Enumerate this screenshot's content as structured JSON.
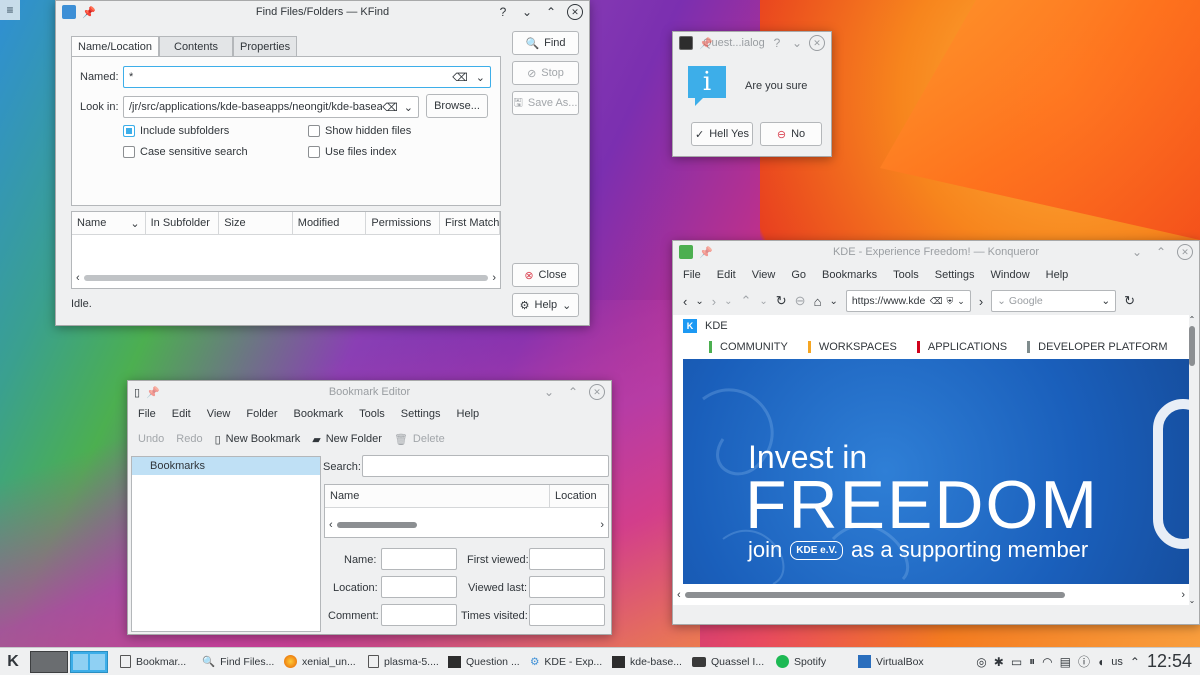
{
  "kfind": {
    "title": "Find Files/Folders — KFind",
    "tabs": [
      "Name/Location",
      "Contents",
      "Properties"
    ],
    "named_label": "Named:",
    "named_value": "*",
    "lookin_label": "Look in:",
    "lookin_value": "/jr/src/applications/kde-baseapps/neongit/kde-baseapps",
    "browse": "Browse...",
    "checks": [
      {
        "label": "Include subfolders",
        "checked": true
      },
      {
        "label": "Show hidden files",
        "checked": false
      },
      {
        "label": "Case sensitive search",
        "checked": false
      },
      {
        "label": "Use files index",
        "checked": false
      }
    ],
    "columns": [
      "Name",
      "In Subfolder",
      "Size",
      "Modified",
      "Permissions",
      "First Match"
    ],
    "find": "Find",
    "stop": "Stop",
    "saveas": "Save As...",
    "close": "Close",
    "help": "Help",
    "status": "Idle."
  },
  "question": {
    "title": "Quest...ialog",
    "text": "Are you sure",
    "yes": "Hell Yes",
    "no": "No"
  },
  "bookmark": {
    "title": "Bookmark Editor",
    "menu": [
      "File",
      "Edit",
      "View",
      "Folder",
      "Bookmark",
      "Tools",
      "Settings",
      "Help"
    ],
    "toolbar": {
      "undo": "Undo",
      "redo": "Redo",
      "new_bookmark": "New Bookmark",
      "new_folder": "New Folder",
      "delete": "Delete"
    },
    "tree_item": "Bookmarks",
    "search_label": "Search:",
    "columns": [
      "Name",
      "Location"
    ],
    "form": {
      "name": "Name:",
      "location": "Location:",
      "comment": "Comment:",
      "first_viewed": "First viewed:",
      "viewed_last": "Viewed last:",
      "times_visited": "Times visited:"
    }
  },
  "konqueror": {
    "title": "KDE - Experience Freedom! — Konqueror",
    "menu": [
      "File",
      "Edit",
      "View",
      "Go",
      "Bookmarks",
      "Tools",
      "Settings",
      "Window",
      "Help"
    ],
    "url": "https://www.kde",
    "search_placeholder": "Google",
    "site_name": "KDE",
    "nav": [
      {
        "label": "COMMUNITY",
        "color": "#4caf50"
      },
      {
        "label": "WORKSPACES",
        "color": "#f5a623"
      },
      {
        "label": "APPLICATIONS",
        "color": "#d0021b"
      },
      {
        "label": "DEVELOPER PLATFORM",
        "color": "#7f8c8d"
      }
    ],
    "banner": {
      "line1": "Invest in",
      "line2": "FREEDOM",
      "line3a": "join",
      "line3b": "as a supporting member",
      "ev_label": "KDE e.V."
    }
  },
  "taskbar": {
    "tasks": [
      "Bookmar...",
      "Find Files...",
      "xenial_un...",
      "plasma-5....",
      "Question ...",
      "KDE - Exp...",
      "kde-base...",
      "Quassel I...",
      "Spotify",
      "VirtualBox"
    ],
    "locale": "us",
    "clock": "12:54"
  }
}
